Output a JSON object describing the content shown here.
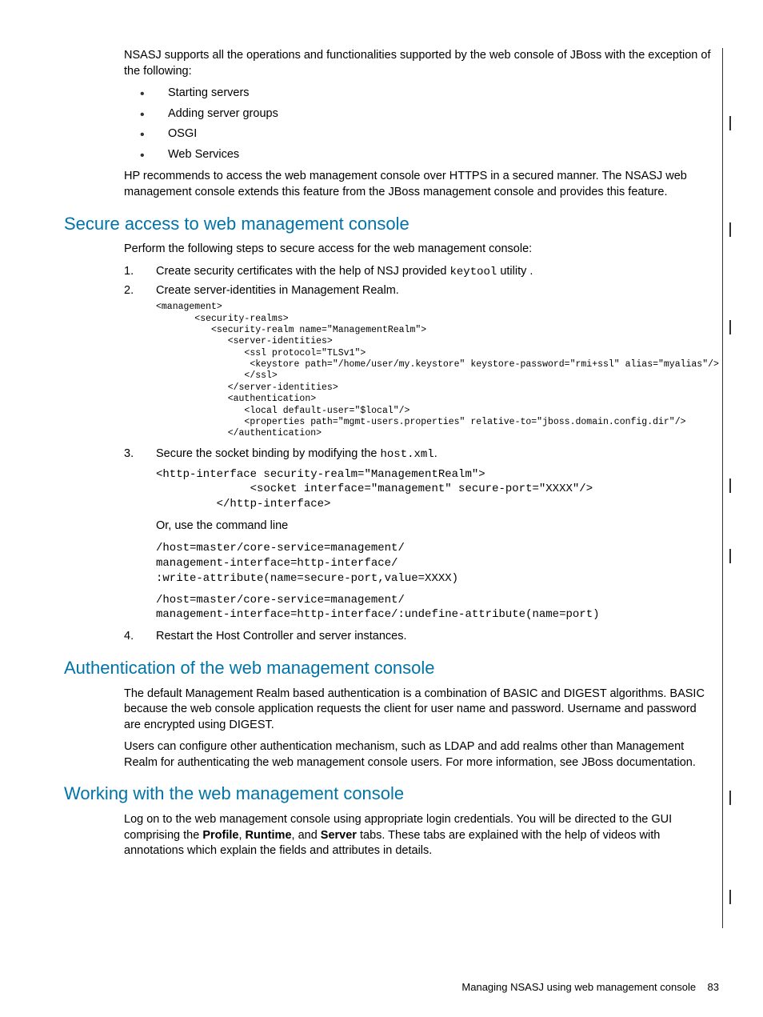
{
  "intro": {
    "p1": "NSASJ supports all the operations and functionalities supported by the web console of JBoss with the exception of the following:",
    "bullets": [
      "Starting servers",
      "Adding server groups",
      "OSGI",
      "Web Services"
    ],
    "p2": "HP recommends to access the web management console over HTTPS in a secured manner. The NSASJ web management console extends this feature from the JBoss management console and provides this feature."
  },
  "secure": {
    "heading": "Secure access to web management console",
    "lead": "Perform the following steps to secure access for the web management console:",
    "step1_a": "Create security certificates with the help of NSJ provided ",
    "step1_code": "keytool",
    "step1_b": " utility .",
    "step2": "Create server-identities in Management Realm.",
    "code2": "<management>\n       <security-realms>\n          <security-realm name=\"ManagementRealm\">\n             <server-identities>\n                <ssl protocol=\"TLSv1\">\n                 <keystore path=\"/home/user/my.keystore\" keystore-password=\"rmi+ssl\" alias=\"myalias\"/>\n                </ssl>\n             </server-identities>\n             <authentication>\n                <local default-user=\"$local\"/>\n                <properties path=\"mgmt-users.properties\" relative-to=\"jboss.domain.config.dir\"/>\n             </authentication>",
    "step3_a": "Secure the socket binding by modifying the ",
    "step3_code": "host.xml",
    "step3_b": ".",
    "code3": "<http-interface security-realm=\"ManagementRealm\">\n              <socket interface=\"management\" secure-port=\"XXXX\"/>\n         </http-interface>",
    "or_text": "Or, use the command line",
    "code_cli1": "/host=master/core-service=management/\nmanagement-interface=http-interface/\n:write-attribute(name=secure-port,value=XXXX)",
    "code_cli2": "/host=master/core-service=management/\nmanagement-interface=http-interface/:undefine-attribute(name=port)",
    "step4": "Restart the Host Controller and server instances."
  },
  "auth": {
    "heading": "Authentication of the web management console",
    "p1": "The default Management Realm based authentication is a combination of BASIC and DIGEST algorithms. BASIC because the web console application requests the client for user name and password. Username and password are encrypted using DIGEST.",
    "p2": "Users can configure other authentication mechanism, such as LDAP and add realms other than Management Realm for authenticating the web management console users. For more information, see JBoss documentation."
  },
  "working": {
    "heading": "Working with the web management console",
    "p1_a": "Log on to the web management console using appropriate login credentials. You will be directed to the GUI comprising the ",
    "p1_profile": "Profile",
    "p1_c1": ", ",
    "p1_runtime": "Runtime",
    "p1_c2": ", and ",
    "p1_server": "Server",
    "p1_b": " tabs. These tabs are explained with the help of videos with annotations which explain the fields and attributes in details."
  },
  "footer": {
    "title": "Managing NSASJ using web management console",
    "page": "83"
  }
}
